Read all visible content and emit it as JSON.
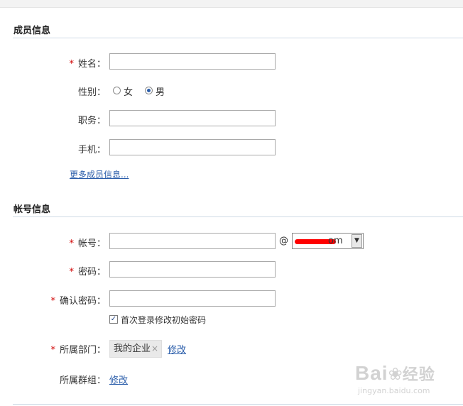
{
  "member_section": {
    "title": "成员信息",
    "name_label": "姓名：",
    "gender_label": "性别：",
    "gender_options": [
      {
        "label": "女",
        "selected": false
      },
      {
        "label": "男",
        "selected": true
      }
    ],
    "position_label": "职务：",
    "phone_label": "手机：",
    "more_link": "更多成员信息..."
  },
  "account_section": {
    "title": "帐号信息",
    "account_label": "帐号：",
    "at_symbol": "@",
    "domain_visible_suffix": "om",
    "password_label": "密码：",
    "confirm_label": "确认密码：",
    "change_pw_checkbox": {
      "label": "首次登录修改初始密码",
      "checked": true
    },
    "dept_label": "所属部门：",
    "dept_tag": "我的企业",
    "dept_tag_remove": "×",
    "dept_edit": "修改",
    "group_label": "所属群组：",
    "group_edit": "修改"
  },
  "required_mark": "*",
  "watermark": {
    "brand": "Bai",
    "brand2": "经验",
    "url": "jingyan.baidu.com"
  },
  "colors": {
    "required": "#d00000",
    "link": "#2a5daa",
    "rule": "#cfdbe6"
  }
}
